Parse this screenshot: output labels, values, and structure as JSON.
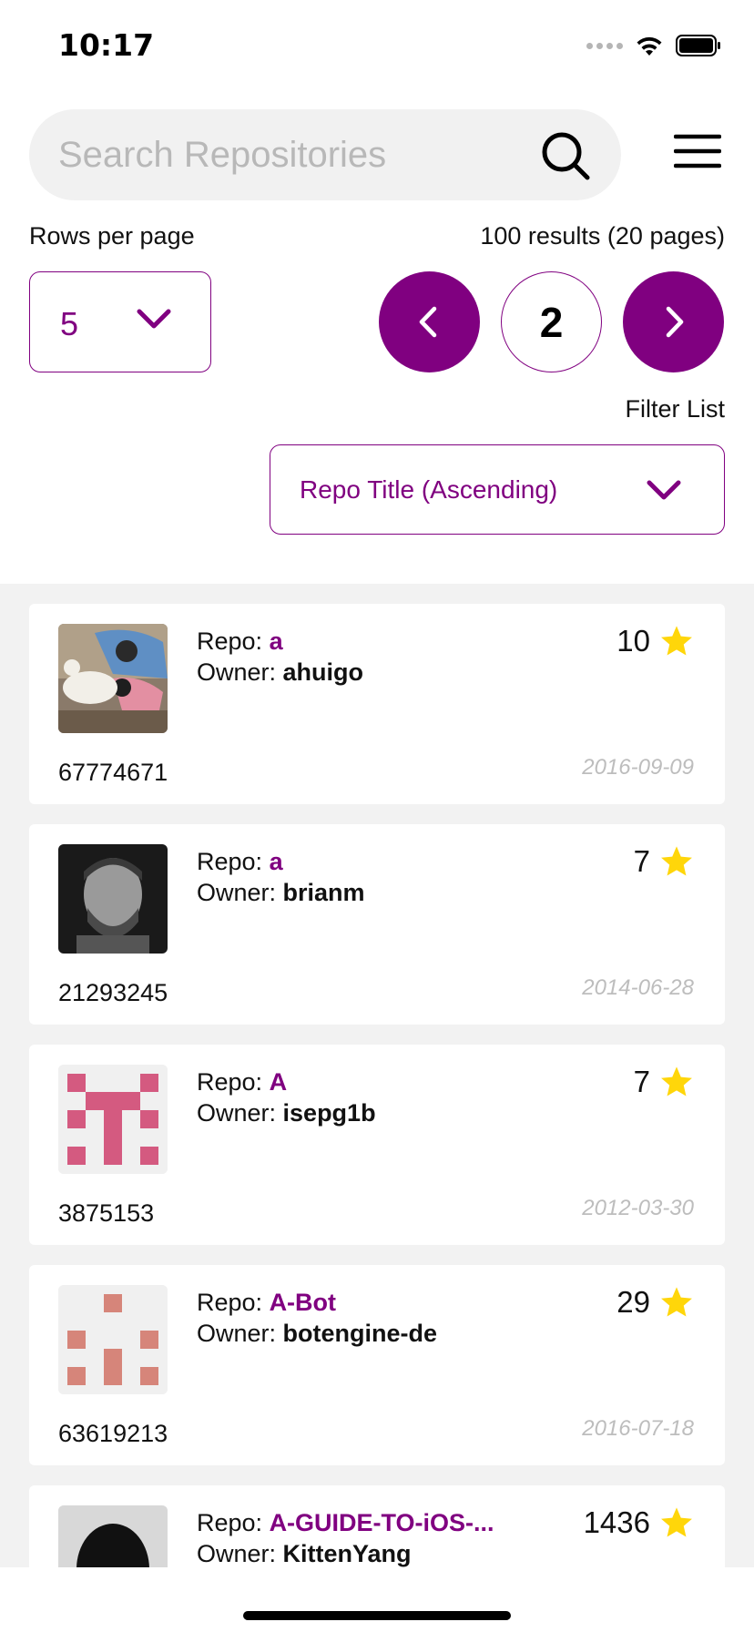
{
  "status_bar": {
    "time": "10:17"
  },
  "search": {
    "placeholder": "Search Repositories",
    "value": ""
  },
  "pagination": {
    "rows_label": "Rows per page",
    "rows_value": "5",
    "results_text": "100 results (20 pages)",
    "current_page": "2"
  },
  "filter": {
    "label": "Filter List",
    "value": "Repo Title (Ascending)"
  },
  "colors": {
    "accent": "#800080",
    "star": "#FFD60A",
    "list_bg": "#F2F2F2",
    "date": "#BDBDBD"
  },
  "labels": {
    "repo": "Repo: ",
    "owner": "Owner: "
  },
  "repos": [
    {
      "repo": "a",
      "owner": "ahuigo",
      "stars": "10",
      "id": "67774671",
      "date": "2016-09-09",
      "avatar": "photo-girl-and-dog"
    },
    {
      "repo": "a",
      "owner": "brianm",
      "stars": "7",
      "id": "21293245",
      "date": "2014-06-28",
      "avatar": "photo-bearded-man"
    },
    {
      "repo": "A",
      "owner": "isepg1b",
      "stars": "7",
      "id": "3875153",
      "date": "2012-03-30",
      "avatar": "identicon-pink"
    },
    {
      "repo": "A-Bot",
      "owner": "botengine-de",
      "stars": "29",
      "id": "63619213",
      "date": "2016-07-18",
      "avatar": "identicon-salmon"
    },
    {
      "repo": "A-GUIDE-TO-iOS-...",
      "owner": "KittenYang",
      "stars": "1436",
      "id": "",
      "date": "",
      "avatar": "photo-silhouette"
    }
  ]
}
